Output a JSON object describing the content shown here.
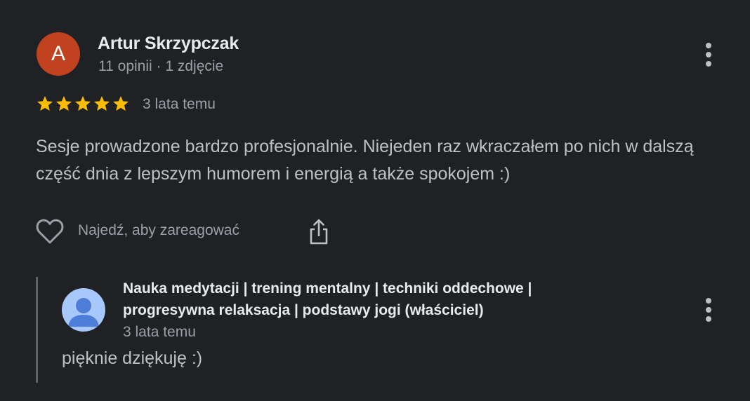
{
  "review": {
    "author_initial": "A",
    "author_name": "Artur Skrzypczak",
    "author_meta": "11 opinii · 1 zdjęcie",
    "rating": 5,
    "rating_max": 5,
    "time": "3 lata temu",
    "text": "Sesje prowadzone bardzo profesjonalnie. Niejeden raz wkraczałem po nich w dalszą część dnia z lepszym humorem i energią a także spokojem :)",
    "react_label": "Najedź, aby zareagować",
    "avatar_color": "#c0421f",
    "star_color": "#fbbc04"
  },
  "reply": {
    "owner_name": "Nauka medytacji | trening mentalny | techniki oddechowe | progresywna relaksacja | podstawy jogi (właściciel)",
    "time": "3 lata temu",
    "text": "pięknie dziękuję :)",
    "avatar_color": "#a8c7fa",
    "avatar_figure_color": "#4d7ed8"
  },
  "icons": {
    "more": "more-vert-icon",
    "like": "heart-outline-icon",
    "share": "share-icon",
    "star": "star-icon",
    "owner_avatar": "person-icon"
  }
}
